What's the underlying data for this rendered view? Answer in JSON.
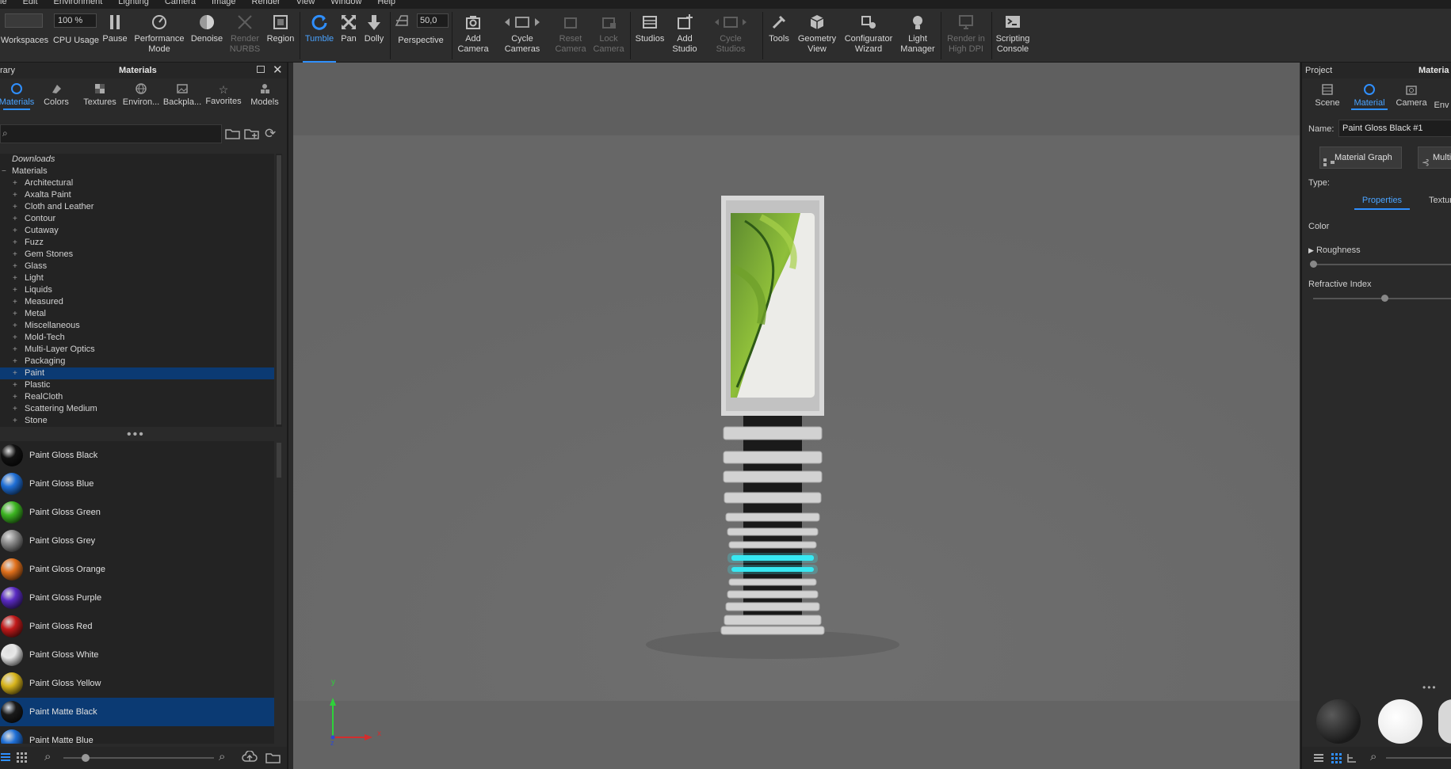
{
  "menu": [
    "le",
    "Edit",
    "Environment",
    "Lighting",
    "Camera",
    "Image",
    "Render",
    "View",
    "Window",
    "Help"
  ],
  "toolbar": {
    "zoom_value": "100 %",
    "fov_value": "50,0",
    "workspaces": "Workspaces",
    "cpu_usage": "CPU Usage",
    "pause": "Pause",
    "performance_mode": "Performance\nMode",
    "denoise": "Denoise",
    "render_nurbs": "Render\nNURBS",
    "region": "Region",
    "tumble": "Tumble",
    "pan": "Pan",
    "dolly": "Dolly",
    "perspective": "Perspective",
    "add_camera": "Add\nCamera",
    "cycle_cameras": "Cycle\nCameras",
    "reset_camera": "Reset\nCamera",
    "lock_camera": "Lock\nCamera",
    "studios": "Studios",
    "add_studio": "Add\nStudio",
    "cycle_studios": "Cycle\nStudios",
    "tools": "Tools",
    "geometry_view": "Geometry\nView",
    "configurator_wizard": "Configurator\nWizard",
    "light_manager": "Light\nManager",
    "render_high_dpi": "Render in\nHigh DPI",
    "scripting_console": "Scripting\nConsole"
  },
  "library": {
    "header_left": "rary",
    "title": "Materials",
    "tabs": [
      "Materials",
      "Colors",
      "Textures",
      "Environ...",
      "Backpla...",
      "Favorites",
      "Models"
    ],
    "tree_top": [
      "Downloads",
      "Materials"
    ],
    "tree_items": [
      "Architectural",
      "Axalta Paint",
      "Cloth and Leather",
      "Contour",
      "Cutaway",
      "Fuzz",
      "Gem Stones",
      "Glass",
      "Light",
      "Liquids",
      "Measured",
      "Metal",
      "Miscellaneous",
      "Mold-Tech",
      "Multi-Layer Optics",
      "Packaging",
      "Paint",
      "Plastic",
      "RealCloth",
      "Scattering Medium",
      "Stone"
    ],
    "selected_tree_item": "Paint",
    "materials": [
      {
        "name": "Paint Gloss Black",
        "color": "#111111"
      },
      {
        "name": "Paint Gloss Blue",
        "color": "#1f6fd6"
      },
      {
        "name": "Paint Gloss Green",
        "color": "#3cb521"
      },
      {
        "name": "Paint Gloss Grey",
        "color": "#8a8a8a"
      },
      {
        "name": "Paint Gloss Orange",
        "color": "#e0701c"
      },
      {
        "name": "Paint Gloss Purple",
        "color": "#5a2bc2"
      },
      {
        "name": "Paint Gloss Red",
        "color": "#c21a1a"
      },
      {
        "name": "Paint Gloss White",
        "color": "#e8e8e8"
      },
      {
        "name": "Paint Gloss Yellow",
        "color": "#d8b51c"
      },
      {
        "name": "Paint Matte Black",
        "color": "#1a1a1a"
      },
      {
        "name": "Paint Matte Blue",
        "color": "#1f6fd6"
      }
    ],
    "selected_material": "Paint Matte Black"
  },
  "project": {
    "header_left": "Project",
    "header_right": "Materia",
    "tabs": [
      "Scene",
      "Material",
      "Camera",
      "Env"
    ],
    "name_label": "Name:",
    "name_value": "Paint Gloss Black #1",
    "material_graph_button": "Material Graph",
    "multi_button": "Multi",
    "type_label": "Type:",
    "subtabs": [
      "Properties",
      "Textur"
    ],
    "color_label": "Color",
    "roughness_label": "Roughness",
    "refractive_index_label": "Refractive Index"
  },
  "axis": {
    "y": "y",
    "x": "x",
    "z": "z"
  }
}
